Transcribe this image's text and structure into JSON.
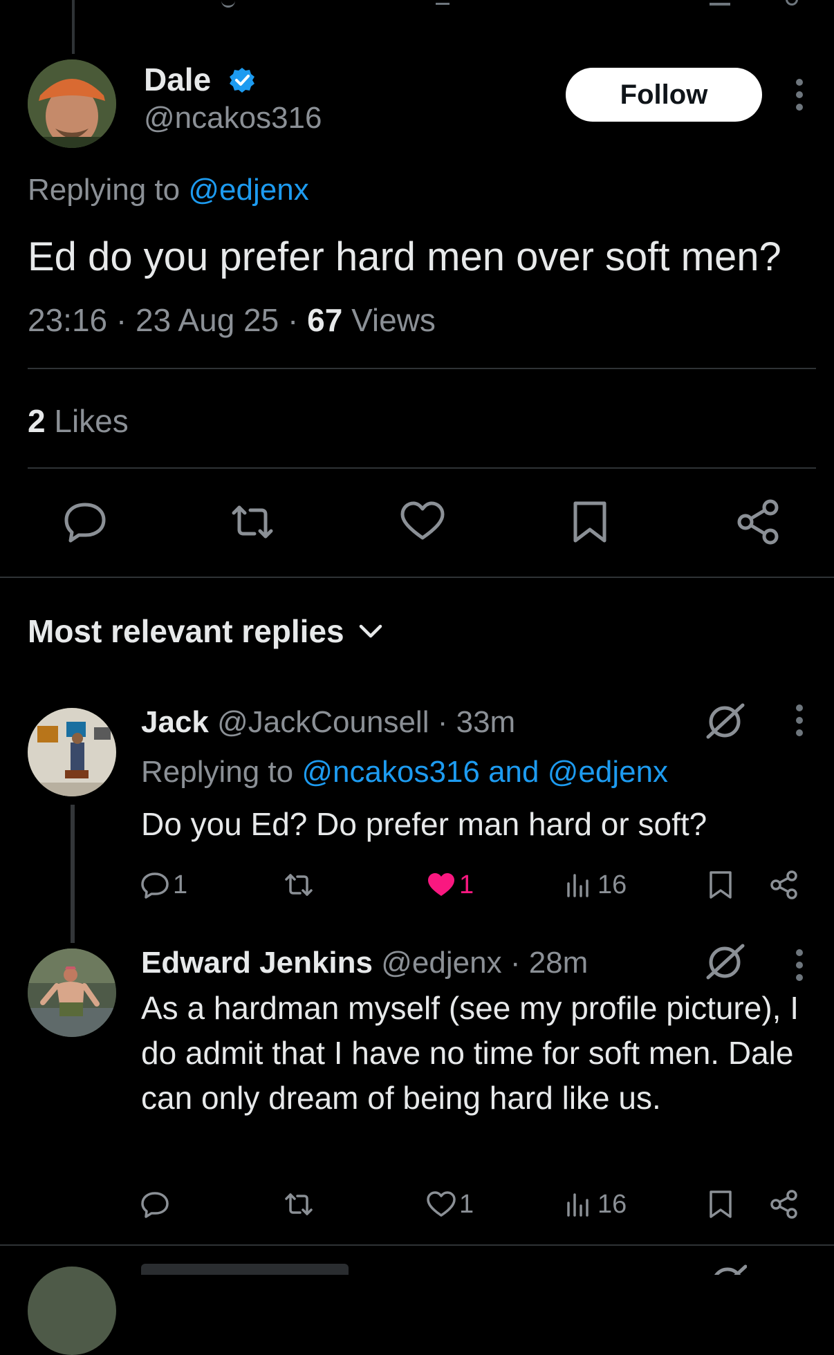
{
  "main_tweet": {
    "author_name": "Dale",
    "author_handle": "@ncakos316",
    "follow_label": "Follow",
    "replying_prefix": "Replying to",
    "replying_to": "@edjenx",
    "text": "Ed do you prefer hard men over soft men?",
    "time": "23:16",
    "date": "23 Aug 25",
    "views_count": "67",
    "views_label": "Views",
    "likes_count": "2",
    "likes_label": "Likes"
  },
  "replies_header": {
    "title": "Most relevant replies"
  },
  "replies": [
    {
      "name": "Jack",
      "handle": "@JackCounsell",
      "time": "33m",
      "replying_prefix": "Replying to",
      "replying_to": "@ncakos316 and @edjenx",
      "text": "Do you Ed? Do prefer man hard or soft?",
      "reply_count": "1",
      "like_count": "1",
      "view_count": "16",
      "liked": true
    },
    {
      "name": "Edward Jenkins",
      "handle": "@edjenx",
      "time": "28m",
      "text": "As a hardman myself (see my profile picture), I do admit that I have no time for soft men. Dale can only dream of being hard like us.",
      "like_count": "1",
      "view_count": "16",
      "liked": false
    }
  ],
  "colors": {
    "background": "#000000",
    "link": "#1d9bf0",
    "like": "#f91880",
    "muted": "#8b9096"
  },
  "icons": [
    "verified-badge-icon",
    "more-icon",
    "reply-icon",
    "retweet-icon",
    "like-icon",
    "bookmark-icon",
    "share-icon",
    "chevron-down-icon",
    "grok-icon",
    "views-icon"
  ]
}
